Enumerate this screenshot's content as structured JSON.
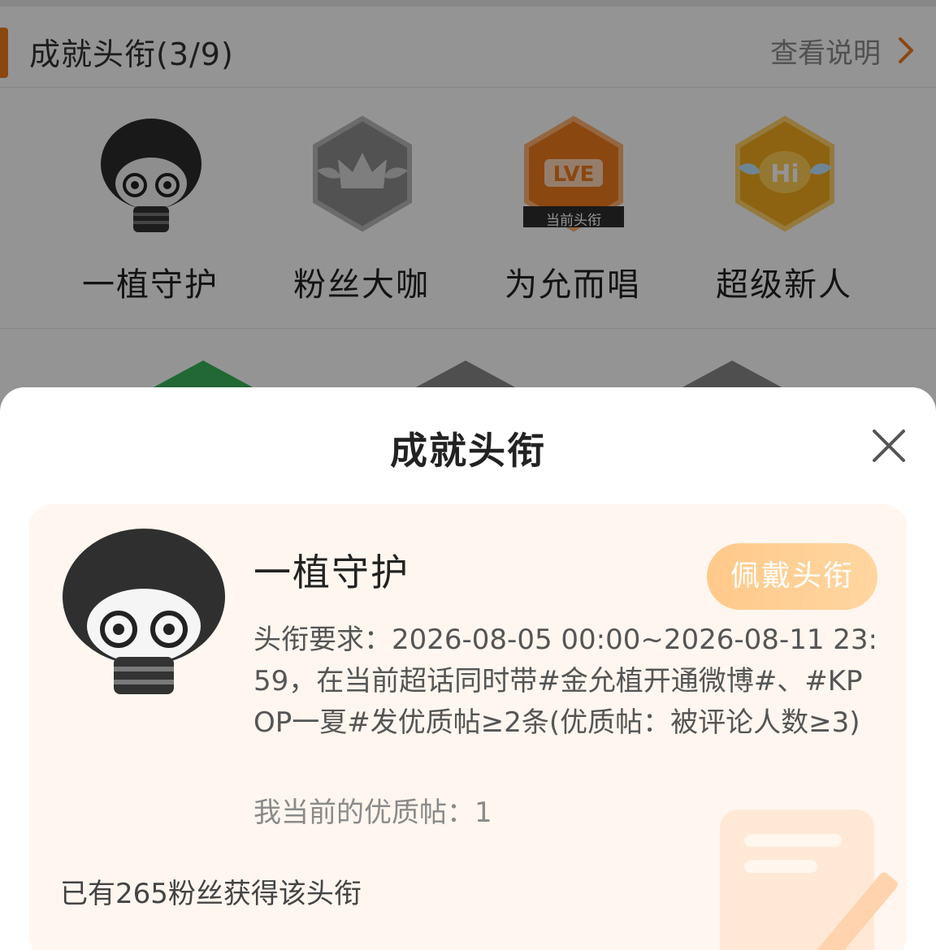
{
  "header": {
    "title": "成就头衔(3/9)",
    "link_label": "查看说明",
    "chevron_icon": "chevron-right-icon",
    "accent_color": "#f07b1c"
  },
  "badges": [
    {
      "name": "一植守护",
      "icon": "chibi-avatar-icon"
    },
    {
      "name": "粉丝大咖",
      "icon": "crown-hex-badge-icon"
    },
    {
      "name": "为允而唱",
      "icon": "lve-hex-badge-icon",
      "ribbon": "当前头衔"
    },
    {
      "name": "超级新人",
      "icon": "hi-hex-badge-icon"
    }
  ],
  "sheet": {
    "title": "成就头衔",
    "close_icon": "close-icon",
    "card": {
      "title": "一植守护",
      "wear_button": "佩戴头衔",
      "requirement": "头衔要求：2026-08-05 00:00~2026-08-11 23:59，在当前超话同时带#金允植开通微博#、#KPOP一夏#发优质帖≥2条(优质帖：被评论人数≥3)",
      "current_status": "我当前的优质帖：1",
      "owners": "已有265粉丝获得该头衔"
    }
  }
}
